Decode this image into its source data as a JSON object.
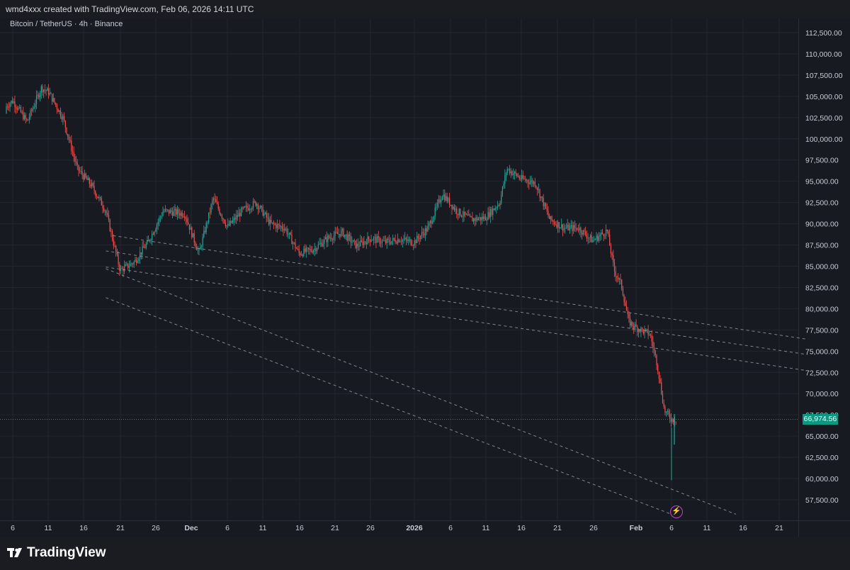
{
  "header": {
    "title": "wmd4xxx created with TradingView.com, Feb 06, 2026 14:11 UTC"
  },
  "symbol_info": "Bitcoin / TetherUS · 4h · Binance",
  "brand": {
    "name": "TradingView"
  },
  "colors": {
    "up": "#26a69a",
    "down": "#ef5350",
    "bg": "#181a22",
    "grid": "#23262f",
    "badge": "#089981"
  },
  "icons": {
    "flash": "lightning-bolt-icon",
    "logo": "tradingview-logo-icon"
  },
  "chart_data": {
    "type": "candlestick",
    "title": "Bitcoin / TetherUS · 4h · Binance",
    "xlabel": "",
    "ylabel": "",
    "ylim": [
      56000,
      113500
    ],
    "x_tick_labels": [
      "6",
      "11",
      "16",
      "21",
      "26",
      "Dec",
      "6",
      "11",
      "16",
      "21",
      "26",
      "2026",
      "6",
      "11",
      "16",
      "21",
      "26",
      "Feb",
      "6",
      "11",
      "16",
      "21"
    ],
    "y_tick_labels": [
      "112,500.00",
      "110,000.00",
      "107,500.00",
      "105,000.00",
      "102,500.00",
      "100,000.00",
      "97,500.00",
      "95,000.00",
      "92,500.00",
      "90,000.00",
      "87,500.00",
      "85,000.00",
      "82,500.00",
      "80,000.00",
      "77,500.00",
      "75,000.00",
      "72,500.00",
      "70,000.00",
      "67,500.00",
      "65,000.00",
      "62,500.00",
      "60,000.00",
      "57,500.00"
    ],
    "last_price": 66974.56,
    "last_price_label": "66,974.56",
    "price_path": [
      {
        "date": "2025-11-04",
        "close": 103000
      },
      {
        "date": "2025-11-06",
        "close": 104500
      },
      {
        "date": "2025-11-08",
        "close": 102000
      },
      {
        "date": "2025-11-10",
        "close": 106000
      },
      {
        "date": "2025-11-11",
        "close": 105500
      },
      {
        "date": "2025-11-13",
        "close": 102500
      },
      {
        "date": "2025-11-15",
        "close": 96500
      },
      {
        "date": "2025-11-17",
        "close": 94500
      },
      {
        "date": "2025-11-19",
        "close": 91500
      },
      {
        "date": "2025-11-21",
        "close": 84500
      },
      {
        "date": "2025-11-23",
        "close": 85500
      },
      {
        "date": "2025-11-25",
        "close": 88000
      },
      {
        "date": "2025-11-27",
        "close": 91500
      },
      {
        "date": "2025-11-30",
        "close": 91200
      },
      {
        "date": "2025-12-02",
        "close": 86500
      },
      {
        "date": "2025-12-04",
        "close": 93000
      },
      {
        "date": "2025-12-06",
        "close": 89600
      },
      {
        "date": "2025-12-08",
        "close": 91500
      },
      {
        "date": "2025-12-10",
        "close": 92500
      },
      {
        "date": "2025-12-12",
        "close": 90000
      },
      {
        "date": "2025-12-14",
        "close": 89500
      },
      {
        "date": "2025-12-16",
        "close": 86500
      },
      {
        "date": "2025-12-18",
        "close": 87000
      },
      {
        "date": "2025-12-20",
        "close": 88300
      },
      {
        "date": "2025-12-22",
        "close": 89000
      },
      {
        "date": "2025-12-24",
        "close": 87400
      },
      {
        "date": "2025-12-26",
        "close": 88300
      },
      {
        "date": "2025-12-28",
        "close": 87800
      },
      {
        "date": "2025-12-30",
        "close": 88200
      },
      {
        "date": "2026-01-01",
        "close": 87800
      },
      {
        "date": "2026-01-03",
        "close": 89500
      },
      {
        "date": "2026-01-05",
        "close": 93500
      },
      {
        "date": "2026-01-07",
        "close": 91500
      },
      {
        "date": "2026-01-09",
        "close": 90500
      },
      {
        "date": "2026-01-11",
        "close": 90700
      },
      {
        "date": "2026-01-13",
        "close": 92500
      },
      {
        "date": "2026-01-14",
        "close": 96500
      },
      {
        "date": "2026-01-16",
        "close": 95300
      },
      {
        "date": "2026-01-18",
        "close": 94800
      },
      {
        "date": "2026-01-20",
        "close": 90500
      },
      {
        "date": "2026-01-22",
        "close": 89500
      },
      {
        "date": "2026-01-24",
        "close": 89500
      },
      {
        "date": "2026-01-26",
        "close": 88000
      },
      {
        "date": "2026-01-28",
        "close": 89200
      },
      {
        "date": "2026-01-29",
        "close": 84500
      },
      {
        "date": "2026-01-30",
        "close": 82800
      },
      {
        "date": "2026-01-31",
        "close": 78500
      },
      {
        "date": "2026-02-01",
        "close": 77800
      },
      {
        "date": "2026-02-03",
        "close": 77000
      },
      {
        "date": "2026-02-04",
        "close": 73500
      },
      {
        "date": "2026-02-05",
        "close": 68000
      },
      {
        "date": "2026-02-06",
        "close": 66974.56
      }
    ],
    "trendlines": [
      {
        "start": {
          "date": "2025-11-20",
          "price": 88600
        },
        "end": {
          "date": "2026-02-25",
          "price": 76400
        }
      },
      {
        "start": {
          "date": "2025-11-19",
          "price": 86800
        },
        "end": {
          "date": "2026-02-25",
          "price": 74600
        }
      },
      {
        "start": {
          "date": "2025-11-19",
          "price": 84900
        },
        "end": {
          "date": "2026-02-25",
          "price": 72700
        }
      },
      {
        "start": {
          "date": "2025-11-19",
          "price": 84700
        },
        "end": {
          "date": "2026-02-15",
          "price": 55800
        }
      },
      {
        "start": {
          "date": "2025-11-19",
          "price": 81300
        },
        "end": {
          "date": "2026-02-06",
          "price": 55800
        }
      }
    ]
  }
}
